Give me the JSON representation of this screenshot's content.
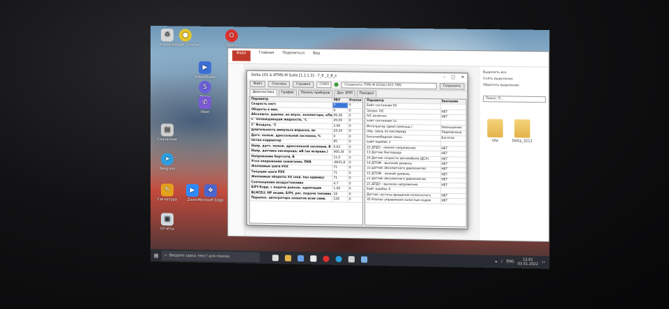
{
  "explorer": {
    "title": "Поиск для диагностики",
    "menu": [
      "Файл",
      "Главная",
      "Поделиться",
      "Вид"
    ],
    "right_panel": [
      "Выделить все",
      "Снять выделение",
      "Обратить выделение"
    ],
    "search": "Поиск: П...",
    "folders": [
      {
        "label": "Uta"
      },
      {
        "label": "Delta_3211"
      }
    ]
  },
  "diag": {
    "title": "Delta 101 & ИТМS-M Suite [1.2.1.3] - 7_6 _2_8_x",
    "toolbar": {
      "file": "Файл",
      "scanner": "Сканеры",
      "help": "Справка",
      "port": "COM3",
      "connect": "Соединить ITMS-M 81[kb] 815 TMS",
      "save": "Сохранить"
    },
    "tabs": [
      "Диагностика",
      "График",
      "Панель приборов",
      "Доп. КПП",
      "Поездка"
    ],
    "left_headers": [
      "Параметр",
      "ЭБУ",
      "Эталон"
    ],
    "left_rows": [
      {
        "p": "Скорость км/ч",
        "v": "0",
        "e": "0"
      },
      {
        "p": "Обороты в мин.",
        "v": "0",
        "e": "0"
      },
      {
        "p": "Абсолютн. давлен. во впуск. коллекторе, кПа",
        "v": "99,28",
        "e": "0"
      },
      {
        "p": "С° Охлаждающей жидкости, °С",
        "v": "26,00",
        "e": "0"
      },
      {
        "p": "С° Воздуха, °С",
        "v": "2,00",
        "e": "0"
      },
      {
        "p": "Длительность импульса впрыска, мс",
        "v": "24,24",
        "e": "0"
      },
      {
        "p": "Датч. полож. дроссельной заслонки, %",
        "v": "0",
        "e": "0"
      },
      {
        "p": "Октан корректор",
        "v": "85",
        "e": "0"
      },
      {
        "p": "Напр. датч. полож. дроссельной заслонки, В",
        "v": "0,63",
        "e": "0"
      },
      {
        "p": "Напр. датчика кислорода, мВ (не исправн.)",
        "v": "460,34",
        "e": "0"
      },
      {
        "p": "Напряжение бортсети, В",
        "v": "11,0",
        "e": "0"
      },
      {
        "p": "Угол опережения зажигания, ПКВ",
        "v": "-8041,8",
        "e": "0"
      },
      {
        "p": "Желаемые шаги РХХ",
        "v": "71",
        "e": "0"
      },
      {
        "p": "Текущие шаги РХХ",
        "v": "71",
        "e": "0"
      },
      {
        "p": "Желаемые обороты ХХ (нов. без единиц)",
        "v": "71",
        "e": "0"
      },
      {
        "p": "Соотношение воздух/топливо",
        "v": "4,7",
        "e": "0"
      },
      {
        "p": "БЛЧ Корр. с подачи дополн. адаптации",
        "v": "1,00",
        "e": "0"
      },
      {
        "p": "BLHCELL НР акции, БЛЧ, рег. подачи топлива",
        "v": "18",
        "e": "0"
      },
      {
        "p": "Перепол. автогратора захватов всеи симв.",
        "v": "128",
        "e": "0"
      }
    ],
    "right_headers": [
      "Параметр",
      "Значение"
    ],
    "right_rows": [
      {
        "p": "Байт состояния 50",
        "v": ""
      },
      {
        "p": "Запрос А/С",
        "v": "НЕТ"
      },
      {
        "p": "А/С включен",
        "v": "НЕТ"
      },
      {
        "p": "Байт состояния 55",
        "v": ""
      },
      {
        "p": "Интегратор (диап./уменьш.)",
        "v": "Уменьшение"
      },
      {
        "p": "Обр. связь по кислороду",
        "v": "Подключена"
      },
      {
        "p": "Богатая/бедная смесь",
        "v": "Богатая"
      },
      {
        "p": "Байт ошибок 3",
        "v": ""
      },
      {
        "p": "22 ДПДЗ - низкое напряжение",
        "v": "НЕТ"
      },
      {
        "p": "13 Датчик Кислорода",
        "v": "НЕТ"
      },
      {
        "p": "24 Датчик скорости автомобиля (ДСА)",
        "v": "НЕТ"
      },
      {
        "p": "14 ДТОЖ - высокий уровень",
        "v": "НЕТ"
      },
      {
        "p": "33 Датчик абсолютного давления во",
        "v": "НЕТ"
      },
      {
        "p": "15 ДТОЖ - низкий уровень",
        "v": "НЕТ"
      },
      {
        "p": "21 Датчик абсолютного давления во",
        "v": "НЕТ"
      },
      {
        "p": "21 ДПДЗ - высокое напряжение",
        "v": "НЕТ"
      },
      {
        "p": "Байт ошибок 4",
        "v": ""
      },
      {
        "p": "Датчик частоты вращения коленчатого",
        "v": "НЕТ"
      },
      {
        "p": "35 Клапан управления холостым ходом",
        "v": "НЕТ"
      }
    ]
  },
  "desktop_icons": [
    "Корзина",
    "Google Chrome",
    "Opera",
    "VideoStudio",
    "Skype",
    "Viber",
    "Скачанное",
    "Telegram",
    "Zoom",
    "Microsoft Edge",
    "Сигнатура",
    "Отчёты"
  ],
  "taskbar": {
    "search_placeholder": "Введите здесь текст для поиска",
    "lang": "ENG",
    "time": "12:01",
    "date": "03.01.2022"
  }
}
